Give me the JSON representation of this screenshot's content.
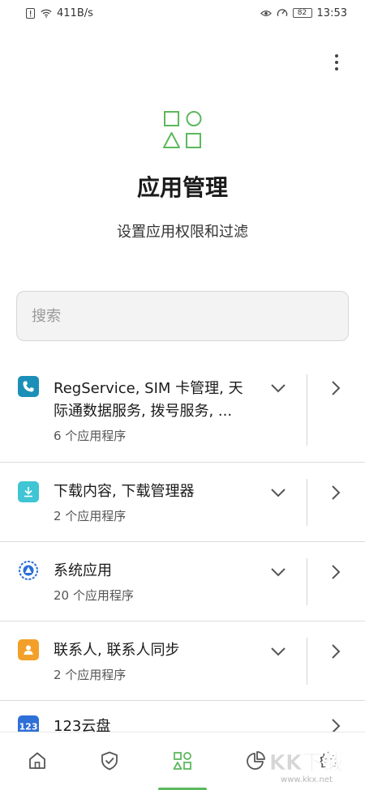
{
  "status_bar": {
    "speed": "411B/s",
    "battery": "82",
    "time": "13:53"
  },
  "header": {
    "title": "应用管理",
    "subtitle": "设置应用权限和过滤"
  },
  "search": {
    "placeholder": "搜索"
  },
  "groups": [
    {
      "title_line1": "RegService, SIM 卡管理, 天",
      "title_line2": "际通数据服务, 拨号服务, ...",
      "count": "6 个应用程序",
      "icon": "phone-icon",
      "color": "#1c8fb8"
    },
    {
      "title_line1": "下载内容, 下载管理器",
      "title_line2": "",
      "count": "2 个应用程序",
      "icon": "download-icon",
      "color": "#3fc5d4"
    },
    {
      "title_line1": "系统应用",
      "title_line2": "",
      "count": "20 个应用程序",
      "icon": "system-app-icon",
      "color": "#2a6fd6"
    },
    {
      "title_line1": "联系人, 联系人同步",
      "title_line2": "",
      "count": "2 个应用程序",
      "icon": "contacts-icon",
      "color": "#f3a02a"
    },
    {
      "title_line1": "123云盘",
      "title_line2": "",
      "count": "",
      "icon": "cloud-drive-icon",
      "color": "#2f6fd8"
    }
  ],
  "watermark": {
    "main": "KK下载",
    "url": "www.kkx.net"
  },
  "colors": {
    "accent": "#5cb85c",
    "divider": "#dcdcdc"
  }
}
